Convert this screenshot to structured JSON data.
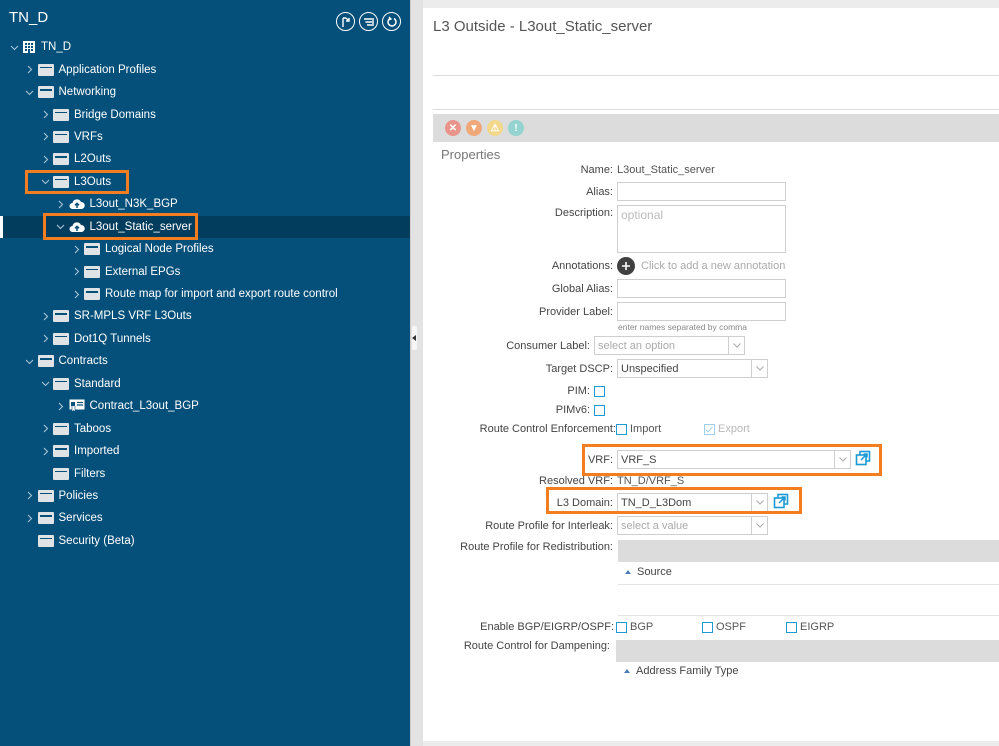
{
  "sidebar": {
    "title": "TN_D",
    "tools": [
      {
        "name": "dock-icon"
      },
      {
        "name": "filter-icon"
      },
      {
        "name": "refresh-icon"
      }
    ],
    "tree": [
      {
        "label": "TN_D",
        "depth": 0,
        "expanded": true,
        "icon": "tenant-icon"
      },
      {
        "label": "Application Profiles",
        "depth": 1,
        "expanded": false,
        "icon": "folder-icon"
      },
      {
        "label": "Networking",
        "depth": 1,
        "expanded": true,
        "icon": "folder-icon"
      },
      {
        "label": "Bridge Domains",
        "depth": 2,
        "expanded": false,
        "icon": "folder-icon"
      },
      {
        "label": "VRFs",
        "depth": 2,
        "expanded": false,
        "icon": "folder-icon"
      },
      {
        "label": "L2Outs",
        "depth": 2,
        "expanded": false,
        "icon": "folder-icon"
      },
      {
        "label": "L3Outs",
        "depth": 2,
        "expanded": true,
        "icon": "folder-icon",
        "highlighted": true
      },
      {
        "label": "L3out_N3K_BGP",
        "depth": 3,
        "expanded": false,
        "icon": "cloud-icon"
      },
      {
        "label": "L3out_Static_server",
        "depth": 3,
        "expanded": true,
        "icon": "cloud-icon",
        "selected": true,
        "highlighted": true
      },
      {
        "label": "Logical Node Profiles",
        "depth": 4,
        "expanded": false,
        "icon": "folder-icon"
      },
      {
        "label": "External EPGs",
        "depth": 4,
        "expanded": false,
        "icon": "folder-icon"
      },
      {
        "label": "Route map for import and export route control",
        "depth": 4,
        "expanded": false,
        "icon": "folder-icon"
      },
      {
        "label": "SR-MPLS VRF L3Outs",
        "depth": 2,
        "expanded": false,
        "icon": "folder-icon"
      },
      {
        "label": "Dot1Q Tunnels",
        "depth": 2,
        "expanded": false,
        "icon": "folder-icon"
      },
      {
        "label": "Contracts",
        "depth": 1,
        "expanded": true,
        "icon": "folder-icon"
      },
      {
        "label": "Standard",
        "depth": 2,
        "expanded": true,
        "icon": "folder-icon"
      },
      {
        "label": "Contract_L3out_BGP",
        "depth": 3,
        "expanded": false,
        "icon": "contract-icon"
      },
      {
        "label": "Taboos",
        "depth": 2,
        "expanded": false,
        "icon": "folder-icon"
      },
      {
        "label": "Imported",
        "depth": 2,
        "expanded": false,
        "icon": "folder-icon"
      },
      {
        "label": "Filters",
        "depth": 2,
        "expanded": null,
        "icon": "folder-icon"
      },
      {
        "label": "Policies",
        "depth": 1,
        "expanded": false,
        "icon": "folder-icon"
      },
      {
        "label": "Services",
        "depth": 1,
        "expanded": false,
        "icon": "folder-icon"
      },
      {
        "label": "Security (Beta)",
        "depth": 1,
        "expanded": null,
        "icon": "folder-icon"
      }
    ]
  },
  "main": {
    "title": "L3 Outside - L3out_Static_server",
    "faults": [
      {
        "name": "critical-fault-icon",
        "color": "#e8948a",
        "glyph": "✕"
      },
      {
        "name": "major-fault-icon",
        "color": "#f0a878",
        "glyph": "▼"
      },
      {
        "name": "minor-fault-icon",
        "color": "#f3d88a",
        "glyph": "⚠"
      },
      {
        "name": "warning-fault-icon",
        "color": "#93d3d0",
        "glyph": "!"
      }
    ],
    "section": "Properties",
    "fields": {
      "name": {
        "label": "Name:",
        "value": "L3out_Static_server"
      },
      "alias": {
        "label": "Alias:",
        "value": ""
      },
      "description": {
        "label": "Description:",
        "placeholder": "optional"
      },
      "annotations": {
        "label": "Annotations:",
        "action": "Click to add a new annotation"
      },
      "global_alias": {
        "label": "Global Alias:",
        "value": ""
      },
      "provider_label": {
        "label": "Provider Label:",
        "value": "",
        "hint": "enter names separated by comma"
      },
      "consumer_label": {
        "label": "Consumer Label:",
        "placeholder": "select an option"
      },
      "target_dscp": {
        "label": "Target DSCP:",
        "value": "Unspecified"
      },
      "pim": {
        "label": "PIM:",
        "checked": false
      },
      "pimv6": {
        "label": "PIMv6:",
        "checked": false
      },
      "route_control": {
        "label": "Route Control Enforcement:",
        "import_label": "Import",
        "import_checked": false,
        "export_label": "Export",
        "export_checked": true
      },
      "vrf": {
        "label": "VRF:",
        "value": "VRF_S"
      },
      "resolved_vrf": {
        "label": "Resolved VRF:",
        "value": "TN_D/VRF_S"
      },
      "l3_domain": {
        "label": "L3 Domain:",
        "value": "TN_D_L3Dom"
      },
      "interleak": {
        "label": "Route Profile for Interleak:",
        "placeholder": "select a value"
      },
      "redistribution": {
        "label": "Route Profile for Redistribution:",
        "column": "Source"
      },
      "routing": {
        "label": "Enable BGP/EIGRP/OSPF:",
        "options": [
          {
            "label": "BGP",
            "checked": false
          },
          {
            "label": "OSPF",
            "checked": false
          },
          {
            "label": "EIGRP",
            "checked": false
          }
        ]
      },
      "dampening": {
        "label": "Route Control for Dampening:",
        "column": "Address Family Type"
      }
    }
  },
  "colors": {
    "sidebar_bg": "#04507a",
    "highlight": "#f47d20",
    "checkbox": "#1b9ad6"
  }
}
